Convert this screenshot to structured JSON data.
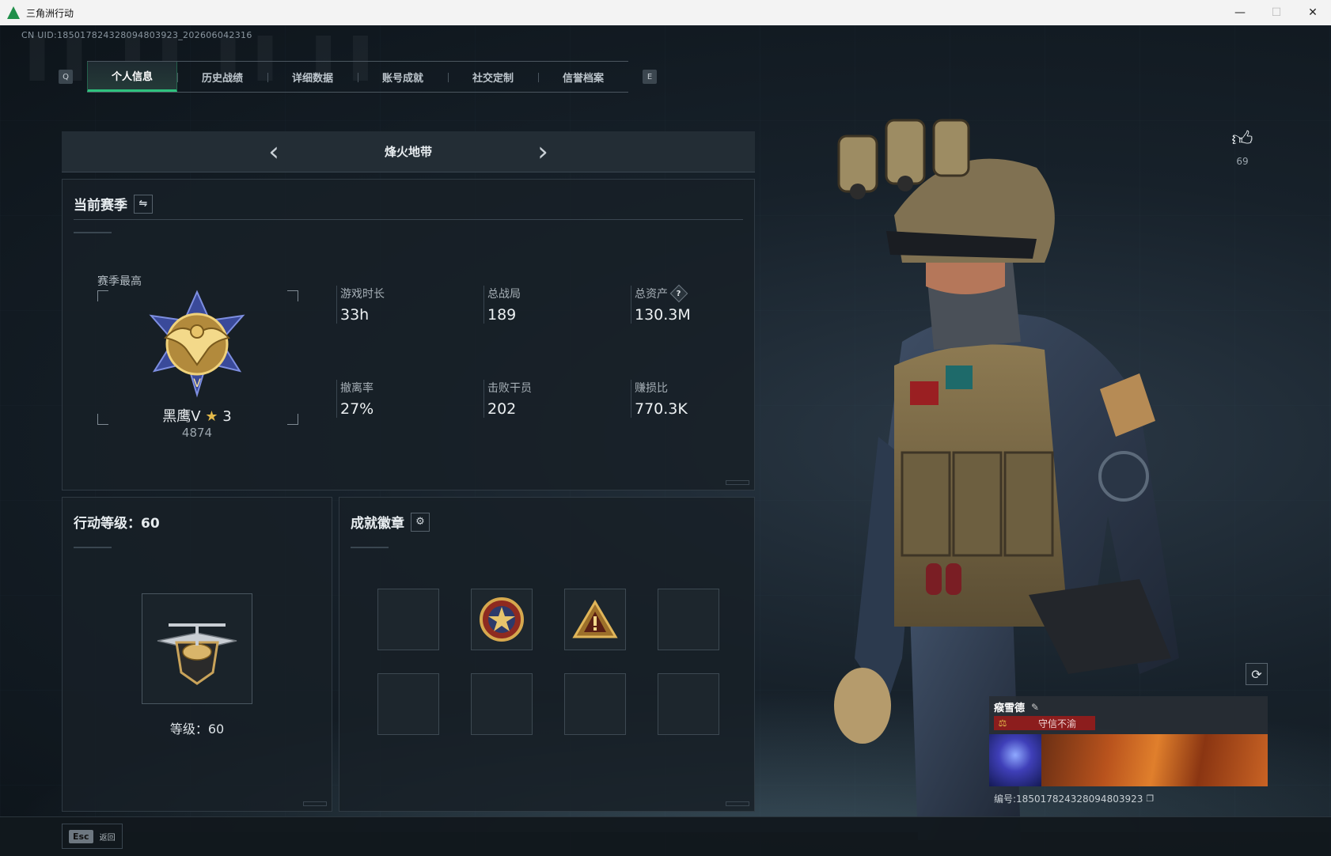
{
  "window": {
    "title": "三角洲行动",
    "controls": [
      "—",
      "☐",
      "✕"
    ]
  },
  "uid_line": "CN UID:185017824328094803923_202606042316",
  "tabs": {
    "left_key": "Q",
    "right_key": "E",
    "items": [
      "个人信息",
      "历史战绩",
      "详细数据",
      "账号成就",
      "社交定制",
      "信誉档案"
    ],
    "active": "个人信息"
  },
  "mode": {
    "title": "烽火地带",
    "prev": "‹",
    "next": "›"
  },
  "season": {
    "heading": "当前赛季",
    "switch_icon": "⇋",
    "peak_label": "赛季最高",
    "rank_name": "黑鹰Ⅴ",
    "rank_stars": "3",
    "rank_score": "4874",
    "stats": [
      {
        "label": "游戏时长",
        "value": "33h"
      },
      {
        "label": "总战局",
        "value": "189"
      },
      {
        "label": "总资产",
        "value": "130.3M",
        "help": "?"
      },
      {
        "label": "撤离率",
        "value": "27%"
      },
      {
        "label": "击败干员",
        "value": "202"
      },
      {
        "label": "赚损比",
        "value": "770.3K"
      }
    ]
  },
  "level": {
    "heading": "行动等级：60",
    "level_text": "等级：60"
  },
  "achievements": {
    "heading": "成就徽章",
    "settings_icon": "⚙"
  },
  "likes": {
    "count": "69",
    "icon": "thumbs-up-icon"
  },
  "card": {
    "name": "瘊雪德",
    "tag": "守信不渝",
    "id": "编号:185017824328094803923"
  },
  "bottom": {
    "esc_key": "Esc",
    "esc_label": "返回"
  },
  "colors": {
    "accent": "#2ec27e",
    "tag_red": "#8c1d1d",
    "gold": "#e3b94a"
  }
}
